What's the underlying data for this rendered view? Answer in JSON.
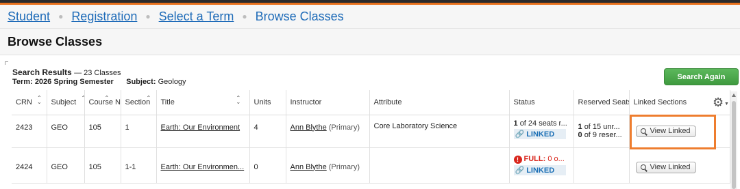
{
  "breadcrumb": {
    "items": [
      "Student",
      "Registration",
      "Select a Term",
      "Browse Classes"
    ]
  },
  "page_title": "Browse Classes",
  "results": {
    "heading": "Search Results",
    "count_text": "— 23 Classes",
    "term_label": "Term:",
    "term_value": "2026 Spring Semester",
    "subject_label": "Subject:",
    "subject_value": "Geology"
  },
  "search_again_label": "Search Again",
  "table": {
    "headers": [
      "CRN",
      "Subject",
      "Course N",
      "Section",
      "Title",
      "Units",
      "Instructor",
      "Attribute",
      "Status",
      "Reserved Seats",
      "Linked Sections"
    ],
    "rows": [
      {
        "crn": "2423",
        "subject": "GEO",
        "course": "105",
        "section": "1",
        "title": "Earth: Our Environment",
        "units": "4",
        "instructor": "Ann Blythe",
        "instructor_role": "(Primary)",
        "attribute": "Core Laboratory Science",
        "status_count": "1",
        "status_text": "of 24 seats r...",
        "linked_label": "LINKED",
        "reserved_line1_count": "1",
        "reserved_line1_text": "of 15 unr...",
        "reserved_line2_count": "0",
        "reserved_line2_text": "of 9 reser...",
        "view_linked_label": "View Linked"
      },
      {
        "crn": "2424",
        "subject": "GEO",
        "course": "105",
        "section": "1-1",
        "title": "Earth: Our Environmen...",
        "units": "0",
        "instructor": "Ann Blythe",
        "instructor_role": "(Primary)",
        "attribute": "",
        "status_full": "FULL:",
        "status_text": "0 o...",
        "linked_label": "LINKED",
        "view_linked_label": "View Linked"
      }
    ]
  },
  "colors": {
    "link": "#1e6bb8",
    "accent_orange": "#ee7d2e",
    "button_green": "#4cae4c",
    "full_red": "#d9261c"
  },
  "icons": {
    "settings": "gear-icon",
    "linked": "link-icon",
    "view": "search-icon",
    "full": "exclamation-icon"
  }
}
